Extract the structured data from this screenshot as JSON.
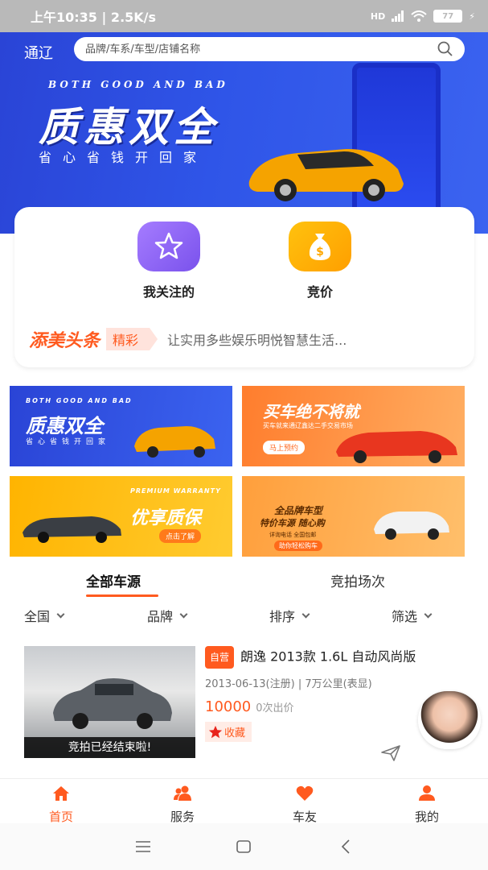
{
  "status_bar": {
    "time": "上午10:35",
    "speed": "| 2.5K/s",
    "network": "HD",
    "battery": "77"
  },
  "header": {
    "city": "通辽",
    "search_placeholder": "品牌/车系/车型/店铺名称"
  },
  "hero": {
    "slogan_en": "BOTH GOOD AND BAD",
    "slogan_cn": "质惠双全",
    "slogan_sub": "省心省钱开回家"
  },
  "quick_actions": [
    {
      "label": "我关注的",
      "icon": "star-icon",
      "color": "#8a63f2"
    },
    {
      "label": "竞价",
      "icon": "money-bag-icon",
      "color": "#ffb400"
    }
  ],
  "news": {
    "brand": "添美头条",
    "tag": "精彩",
    "text": "让实用多些娱乐明悦智慧生活..."
  },
  "promos": [
    {
      "title": "质惠双全",
      "subtitle_en": "BOTH GOOD AND BAD",
      "subtitle": "省心省钱开回家"
    },
    {
      "title": "买车绝不将就",
      "subtitle": "买车就来通辽鑫达二手交易市场",
      "button": "马上预约"
    },
    {
      "title": "优享质保",
      "subtitle_en": "PREMIUM WARRANTY",
      "button": "点击了解"
    },
    {
      "title": "全品牌车型",
      "subtitle": "特价车源  随心购",
      "extra": "详询电话  全国包邮",
      "button": "助你轻松购车"
    }
  ],
  "tabs": [
    {
      "label": "全部车源",
      "active": true
    },
    {
      "label": "竞拍场次",
      "active": false
    }
  ],
  "filters": [
    "全国",
    "品牌",
    "排序",
    "筛选"
  ],
  "listing": {
    "badge": "自营",
    "title": "朗逸 2013款 1.6L 自动风尚版",
    "meta": "2013-06-13(注册) | 7万公里(表显)",
    "price": "10000",
    "bids": "0次出价",
    "favorite": "收藏",
    "status": "竞拍已经结束啦!"
  },
  "bottom_nav": [
    {
      "label": "首页",
      "icon": "home-icon",
      "active": true
    },
    {
      "label": "服务",
      "icon": "people-icon",
      "active": false
    },
    {
      "label": "车友",
      "icon": "heart-icon",
      "active": false
    },
    {
      "label": "我的",
      "icon": "user-icon",
      "active": false
    }
  ],
  "colors": {
    "accent": "#ff5a1f",
    "hero_blue": "#2f55e8"
  }
}
